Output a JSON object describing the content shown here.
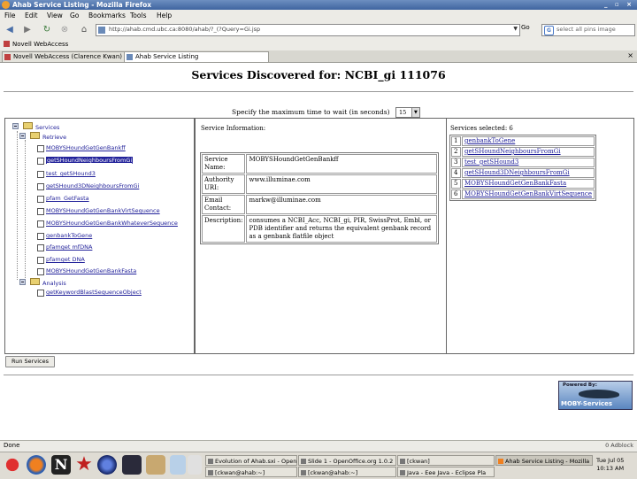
{
  "window": {
    "title": "Ahab Service Listing - Mozilla Firefox",
    "controls": "_ ▫ ×"
  },
  "menubar": [
    "File",
    "Edit",
    "View",
    "Go",
    "Bookmarks",
    "Tools",
    "Help"
  ],
  "navbar": {
    "url": "http://ahab.cmd.ubc.ca:8080/ahab/?_(?Query=Gi.jsp",
    "go_label": "Go",
    "search_value": "select all pins image"
  },
  "bookmarks": [
    "Novell WebAccess"
  ],
  "tabs": [
    {
      "label": "Novell WebAccess (Clarence Kwan)"
    },
    {
      "label": "Ahab Service Listing"
    }
  ],
  "page": {
    "title": "Services Discovered for: NCBI_gi 111076",
    "wait_label": "Specify the maximum time to wait (in seconds)",
    "wait_value": "15",
    "tree": {
      "root": "Services",
      "group1": "Retrieve",
      "items1": [
        "MOBYSHoundGetGenBankff",
        "getSHoundNeighboursFromGi",
        "test_getSHound3",
        "getSHound3DNeighboursFromGi",
        "pfam_GetFasta",
        "MOBYSHoundGetGenBankVirtSequence",
        "MOBYSHoundGetGenBankWhateverSequence",
        "genbankToGene",
        "pfamget mfDNA",
        "pfamget DNA",
        "MOBYSHoundGetGenBankFasta"
      ],
      "group2": "Analysis",
      "items2": [
        "getKeywordBlastSequenceObject"
      ]
    },
    "info": {
      "heading": "Service Information:",
      "rows": [
        {
          "key": "Service Name:",
          "value": "MOBYSHoundGetGenBankff"
        },
        {
          "key": "Authority URI:",
          "value": "www.illuminae.com"
        },
        {
          "key": "Email Contact:",
          "value": "markw@illuminae.com"
        },
        {
          "key": "Description:",
          "value": "consumes a NCBI_Acc, NCBI_gi, PIR, SwissProt, Embl, or PDB identifier and returns the equivalent genbank record as a genbank flatfile object"
        }
      ]
    },
    "selected": {
      "heading": "Services selected: 6",
      "items": [
        {
          "n": "1",
          "name": "genbankToGene"
        },
        {
          "n": "2",
          "name": "getSHoundNeighboursFromGi"
        },
        {
          "n": "3",
          "name": "test_getSHound3"
        },
        {
          "n": "4",
          "name": "getSHound3DNeighboursFromGi"
        },
        {
          "n": "5",
          "name": "MOBYSHoundGetGenBankFasta"
        },
        {
          "n": "6",
          "name": "MOBYSHoundGetGenBankVirtSequence"
        }
      ]
    },
    "run_label": "Run Services",
    "logo": {
      "powered_by": "Powered By:",
      "name": "MOBY-Services"
    }
  },
  "status": {
    "text": "Done",
    "right": "0  Adblock"
  },
  "taskbar": {
    "tasks": [
      {
        "label": "Evolution of Ahab.sxi - OpenO"
      },
      {
        "label": "Slide 1 - OpenOffice.org 1.0.2"
      },
      {
        "label": "[ckwan]"
      },
      {
        "label": "Ahab Service Listing - Mozilla"
      },
      {
        "label": "[ckwan@ahab:~]"
      },
      {
        "label": "[ckwan@ahab:~]"
      },
      {
        "label": "Java - Eee Java - Eclipse Pla"
      }
    ],
    "clock_date": "Tue Jul 05",
    "clock_time": "10:13 AM"
  },
  "colors": {
    "link": "#22229a",
    "titlebar": "#4a6fa8"
  }
}
